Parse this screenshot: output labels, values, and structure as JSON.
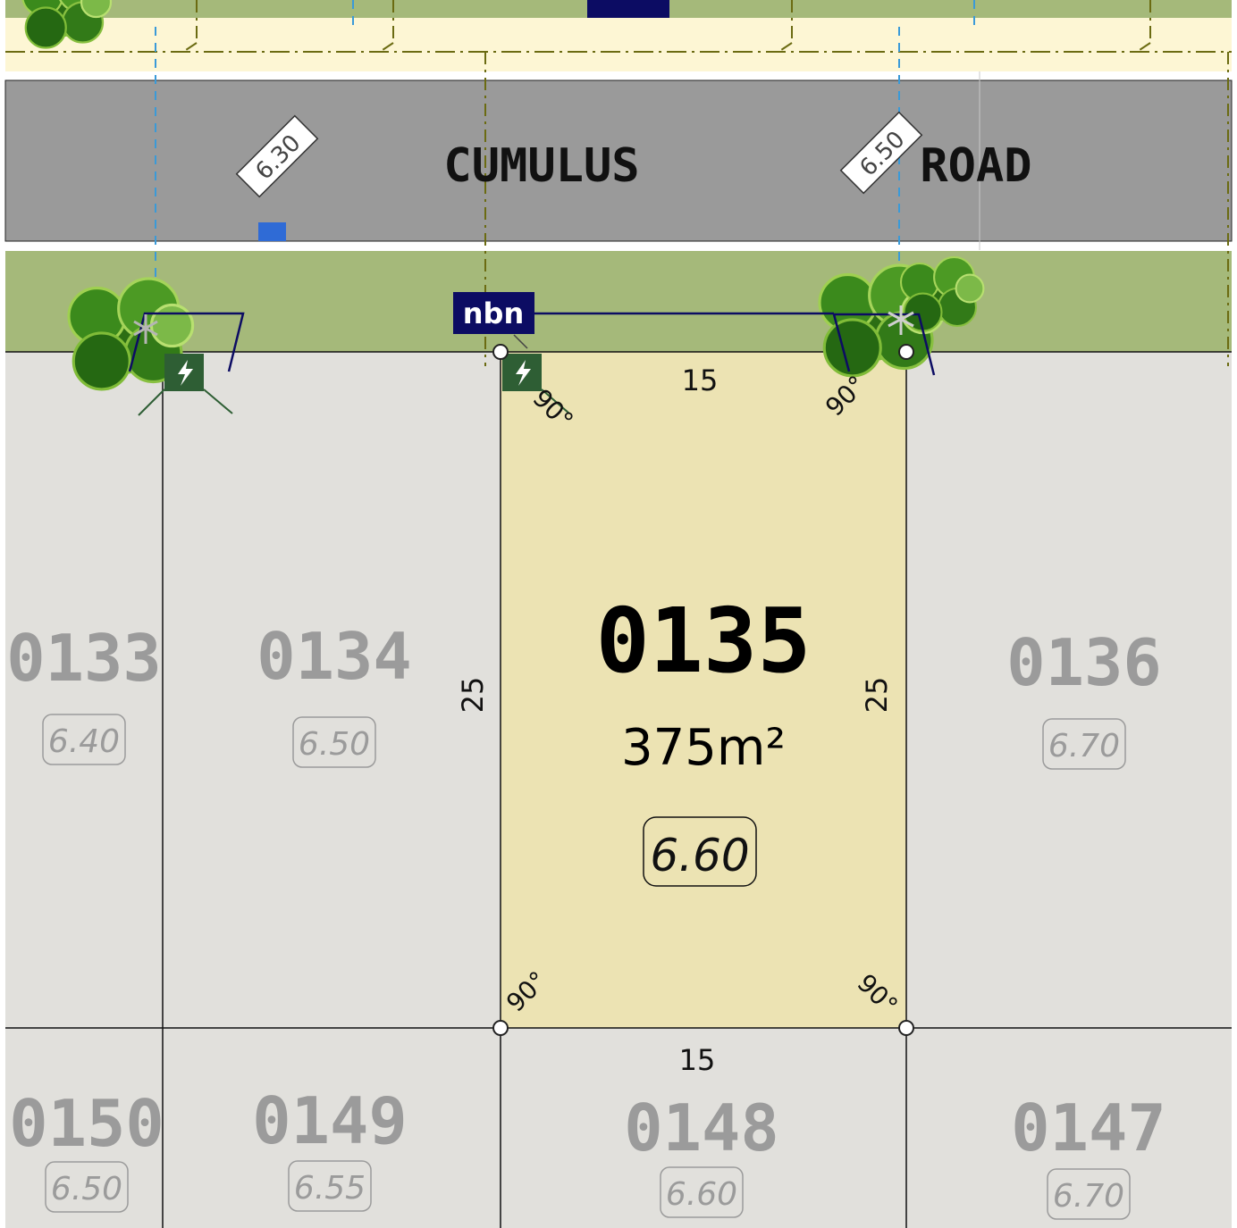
{
  "road": {
    "name_left": "CUMULUS",
    "name_right": "ROAD",
    "levels": [
      "6.30",
      "6.50"
    ]
  },
  "services": {
    "nbn_label": "nbn",
    "nbn_top_label": "nbn"
  },
  "featured_lot": {
    "number": "0135",
    "area": "375m²",
    "level": "6.60",
    "frontage": "15",
    "rear": "15",
    "depth_left": "25",
    "depth_right": "25",
    "angle": "90°"
  },
  "lots": [
    {
      "number": "0133",
      "level": "6.40"
    },
    {
      "number": "0134",
      "level": "6.50"
    },
    {
      "number": "0136",
      "level": "6.70"
    },
    {
      "number": "0150",
      "level": "6.50"
    },
    {
      "number": "0149",
      "level": "6.55"
    },
    {
      "number": "0148",
      "level": "6.60"
    },
    {
      "number": "0147",
      "level": "6.70"
    }
  ],
  "colors": {
    "road": "#9a9a9a",
    "verge": "#a5b97a",
    "footpath": "#fdf6d4",
    "lot_neutral": "#e1e0dc",
    "lot_featured": "#ece3b3",
    "nbn": "#0c0c63",
    "power": "#2e5e34",
    "dash_olive": "#6b6b12",
    "dash_blue": "#3a9ad8"
  }
}
